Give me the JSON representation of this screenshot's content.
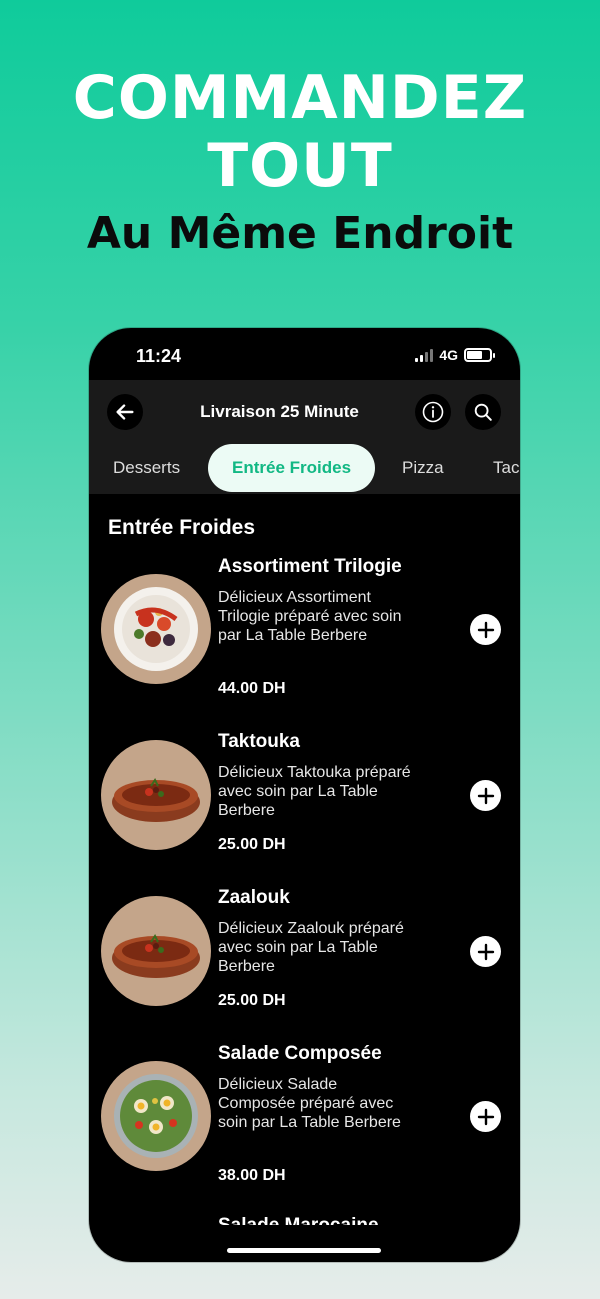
{
  "headline": {
    "line1": "COMMANDEZ",
    "line2": "TOUT",
    "line3": "Au Même Endroit"
  },
  "status_bar": {
    "time": "11:24",
    "network": "4G"
  },
  "topbar": {
    "title": "Livraison 25 Minute"
  },
  "tabs": [
    {
      "label": "Desserts",
      "active": false
    },
    {
      "label": "Entrée Froides",
      "active": true
    },
    {
      "label": "Pizza",
      "active": false
    },
    {
      "label": "Tac",
      "active": false
    }
  ],
  "section": {
    "title": "Entrée Froides"
  },
  "items": [
    {
      "name": "Assortiment Trilogie",
      "description": "Délicieux Assortiment Trilogie préparé avec soin par La Table Berbere",
      "price": "44.00 DH",
      "image": "salad-plate"
    },
    {
      "name": "Taktouka",
      "description": "Délicieux Taktouka préparé avec soin par La Table Berbere",
      "price": "25.00 DH",
      "image": "tagine-dish"
    },
    {
      "name": "Zaalouk",
      "description": "Délicieux Zaalouk préparé avec soin par La Table Berbere",
      "price": "25.00 DH",
      "image": "tagine-dish"
    },
    {
      "name": "Salade Composée",
      "description": "Délicieux Salade Composée préparé avec soin par La Table Berbere",
      "price": "38.00 DH",
      "image": "mixed-salad"
    }
  ],
  "peek_item": {
    "name": "Salade Marocaine"
  },
  "colors": {
    "accent": "#12b884",
    "background_top": "#0fcb9b",
    "active_tab_bg": "#ecfbf5"
  }
}
